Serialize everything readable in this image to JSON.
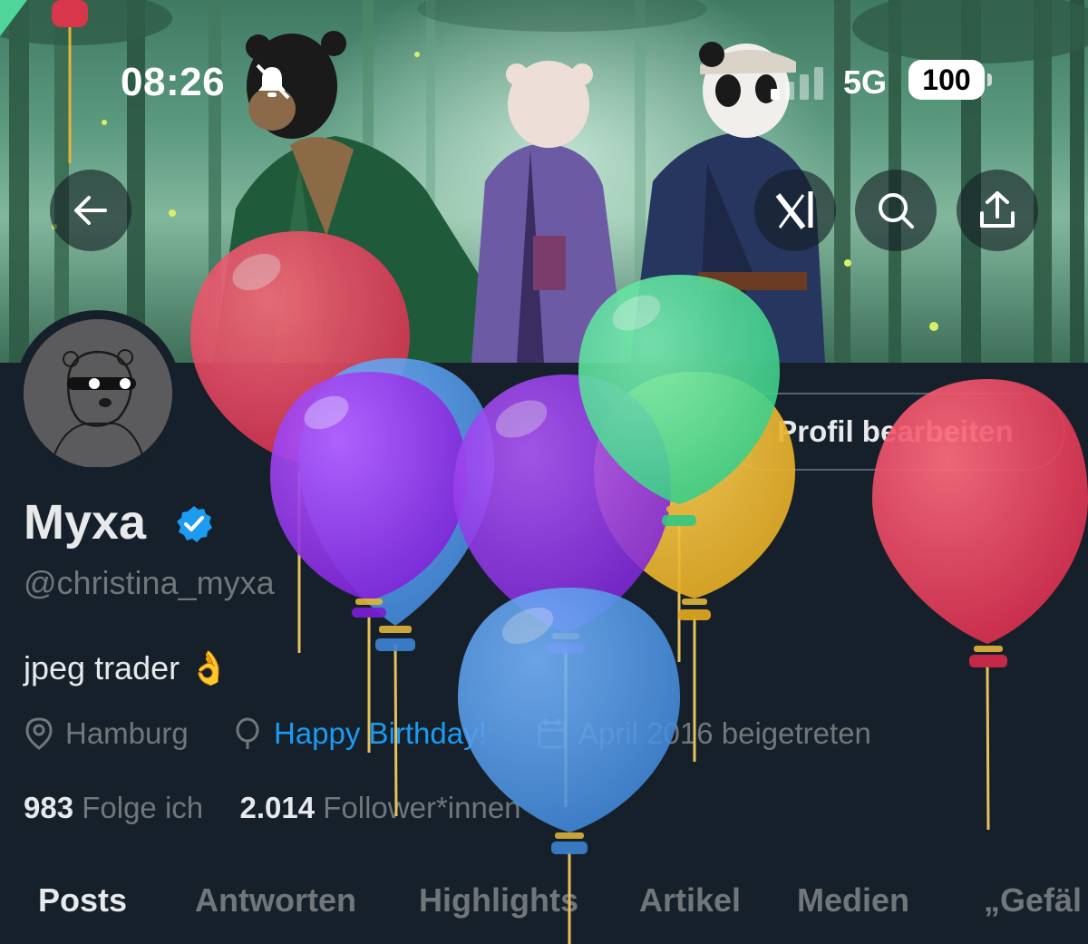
{
  "status_bar": {
    "time": "08:26",
    "network": "5G",
    "battery": "100"
  },
  "header": {
    "back_icon": "arrow-left-icon",
    "grok_icon": "grok-icon",
    "search_icon": "search-icon",
    "share_icon": "share-icon"
  },
  "profile": {
    "display_name": "Myxa",
    "handle": "@christina_myxa",
    "bio": "jpeg trader 👌",
    "edit_button": "Profil bearbeiten",
    "location": "Hamburg",
    "birthday": "Happy Birthday!",
    "joined": "April 2016 beigetreten",
    "following_count": "983",
    "following_label": "Folge ich",
    "followers_count": "2.014",
    "followers_label": "Follower*innen"
  },
  "tabs": [
    {
      "label": "Posts",
      "active": true
    },
    {
      "label": "Antworten",
      "active": false
    },
    {
      "label": "Highlights",
      "active": false
    },
    {
      "label": "Artikel",
      "active": false
    },
    {
      "label": "Medien",
      "active": false
    },
    {
      "label": "„Gefäl",
      "active": false
    }
  ],
  "colors": {
    "background": "#15202b",
    "accent": "#1d9bf0",
    "muted_text": "#71767b",
    "primary_text": "#e7e9ea"
  }
}
